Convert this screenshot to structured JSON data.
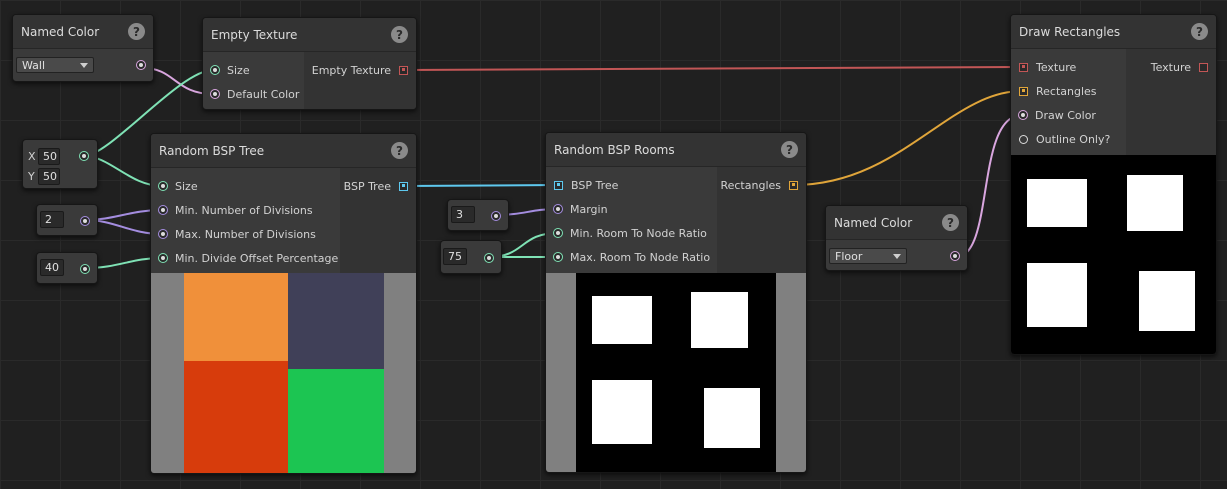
{
  "colors": {
    "wire_size": "#7fe2b5",
    "wire_color": "#d9a6df",
    "wire_int": "#a48de0",
    "wire_texture": "#c25656",
    "wire_bsp": "#5ec8ee",
    "wire_rect": "#e0a53a",
    "bsp_orange": "#f0903a",
    "bsp_slate": "#404058",
    "bsp_red": "#d73c0c",
    "bsp_green": "#1cc552"
  },
  "nodes": {
    "named_color_wall": {
      "title": "Named Color",
      "value": "Wall"
    },
    "empty_texture": {
      "title": "Empty Texture",
      "inputs": [
        "Size",
        "Default Color"
      ],
      "output": "Empty Texture"
    },
    "vector_input": {
      "x_label": "X",
      "x_value": "50",
      "y_label": "Y",
      "y_value": "50"
    },
    "int_input_divisions": {
      "value": "2"
    },
    "int_input_offset": {
      "value": "40"
    },
    "random_bsp_tree": {
      "title": "Random BSP Tree",
      "inputs": [
        "Size",
        "Min. Number of Divisions",
        "Max. Number of Divisions",
        "Min. Divide Offset Percentage"
      ],
      "output": "BSP Tree"
    },
    "int_input_margin": {
      "value": "3"
    },
    "int_input_ratio": {
      "value": "75"
    },
    "random_bsp_rooms": {
      "title": "Random BSP Rooms",
      "inputs": [
        "BSP Tree",
        "Margin",
        "Min. Room To Node Ratio",
        "Max. Room To Node Ratio"
      ],
      "output": "Rectangles"
    },
    "named_color_floor": {
      "title": "Named Color",
      "value": "Floor"
    },
    "draw_rectangles": {
      "title": "Draw Rectangles",
      "inputs": [
        "Texture",
        "Rectangles",
        "Draw Color",
        "Outline Only?"
      ],
      "output": "Texture"
    }
  },
  "help_glyph": "?"
}
